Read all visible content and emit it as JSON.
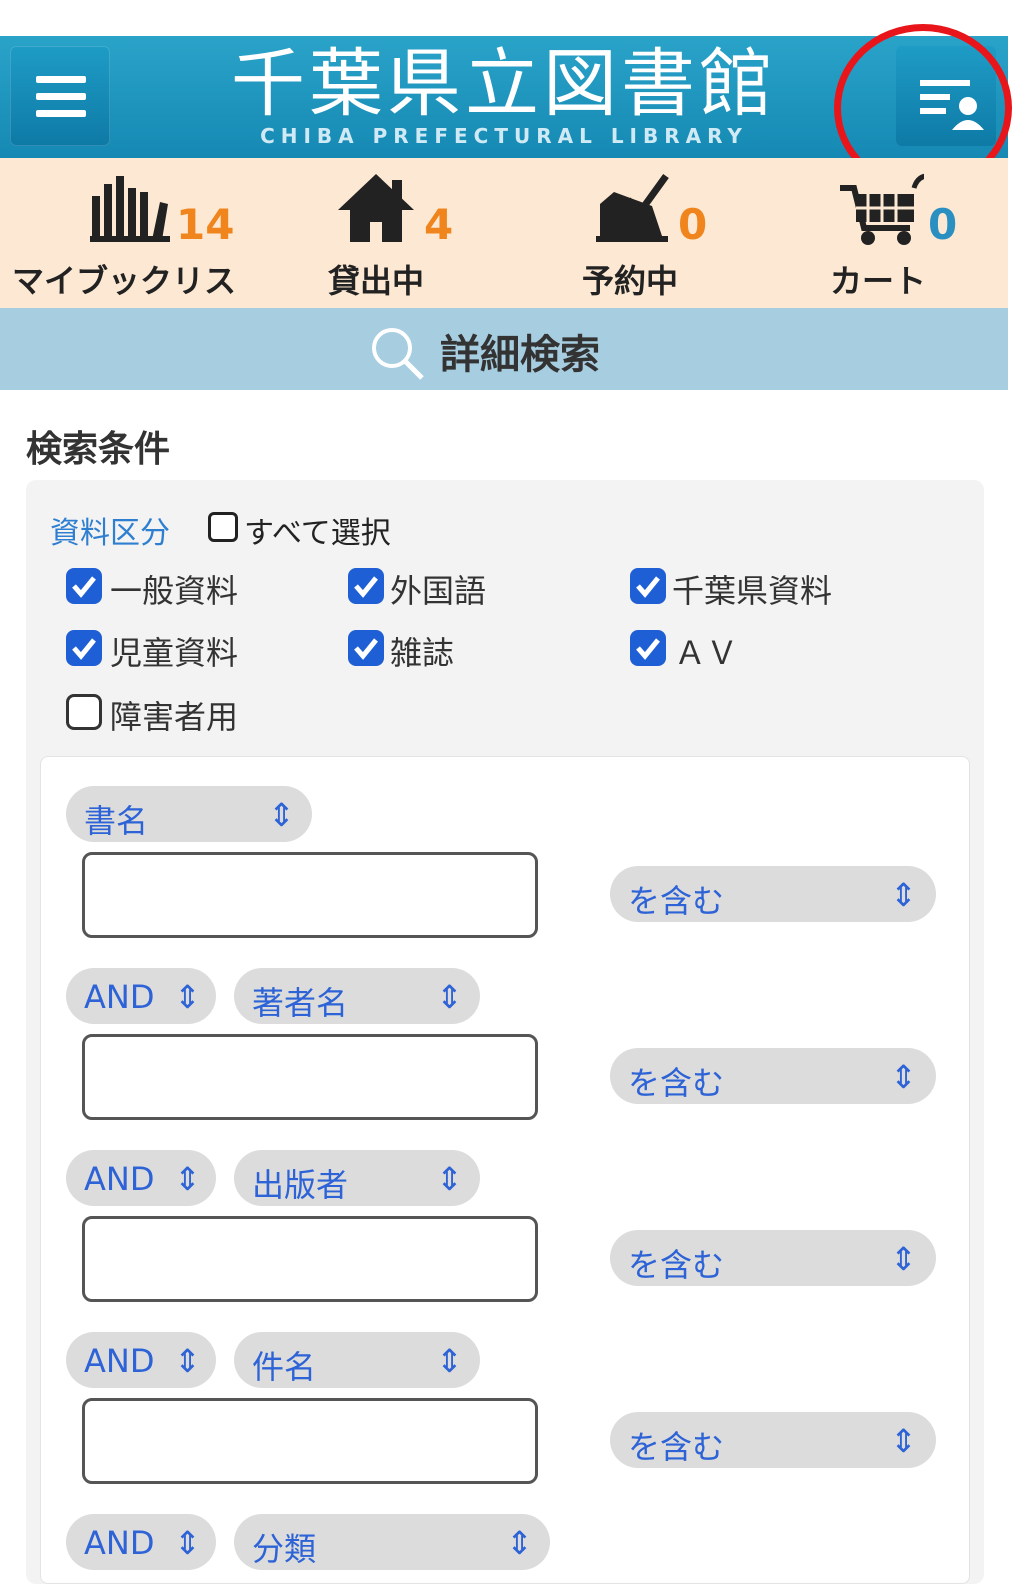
{
  "header": {
    "logo_title": "千葉県立図書館",
    "logo_subtitle": "CHIBA PREFECTURAL LIBRARY"
  },
  "status": {
    "mybooklist": {
      "count": "14",
      "label": "マイブックリス"
    },
    "lending": {
      "count": "4",
      "label": "貸出中"
    },
    "reserved": {
      "count": "0",
      "label": "予約中"
    },
    "cart": {
      "count": "0",
      "label": "カート"
    }
  },
  "search": {
    "title": "詳細検索",
    "conditions_title": "検索条件"
  },
  "categories": {
    "label": "資料区分",
    "select_all_label": "すべて選択",
    "items": [
      {
        "label": "一般資料",
        "checked": true
      },
      {
        "label": "外国語",
        "checked": true
      },
      {
        "label": "千葉県資料",
        "checked": true
      },
      {
        "label": "児童資料",
        "checked": true
      },
      {
        "label": "雑誌",
        "checked": true
      },
      {
        "label": "ＡＶ",
        "checked": true
      },
      {
        "label": "障害者用",
        "checked": false
      }
    ]
  },
  "form": {
    "rows": [
      {
        "operator": "",
        "field": "書名",
        "match": "を含む",
        "value": ""
      },
      {
        "operator": "AND",
        "field": "著者名",
        "match": "を含む",
        "value": ""
      },
      {
        "operator": "AND",
        "field": "出版者",
        "match": "を含む",
        "value": ""
      },
      {
        "operator": "AND",
        "field": "件名",
        "match": "を含む",
        "value": ""
      },
      {
        "operator": "AND",
        "field": "分類",
        "match": "",
        "value": ""
      }
    ]
  },
  "colors": {
    "header": "#1a93bd",
    "status_bg": "#fde9d3",
    "count": "#f0851e",
    "banner": "#a7cde0",
    "checkbox": "#1f5fd6",
    "highlight": "#e8161a"
  }
}
